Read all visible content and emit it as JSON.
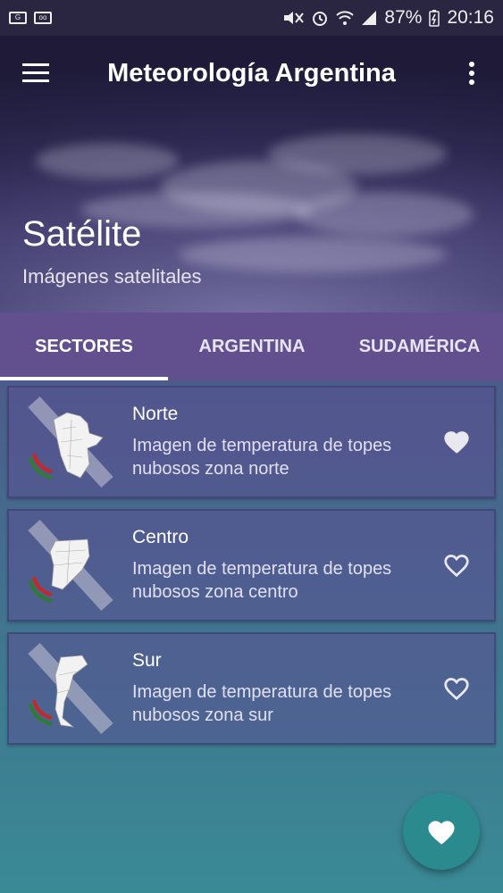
{
  "status_bar": {
    "battery": "87%",
    "time": "20:16",
    "left_icons": [
      "gallery-icon",
      "voicemail-icon"
    ],
    "right_icons": [
      "mute-icon",
      "alarm-icon",
      "wifi-icon",
      "signal-icon",
      "battery-icon"
    ]
  },
  "app_bar": {
    "title": "Meteorología Argentina",
    "menu_icon": "hamburger-menu-icon",
    "more_icon": "more-vert-icon"
  },
  "hero": {
    "title": "Satélite",
    "subtitle": "Imágenes satelitales"
  },
  "tabs": [
    {
      "label": "SECTORES",
      "active": true
    },
    {
      "label": "ARGENTINA",
      "active": false
    },
    {
      "label": "SUDAMÉRICA",
      "active": false
    }
  ],
  "items": [
    {
      "title": "Norte",
      "description": "Imagen de temperatura de topes nubosos zona norte",
      "favorite": true
    },
    {
      "title": "Centro",
      "description": "Imagen de temperatura de topes nubosos zona centro",
      "favorite": false
    },
    {
      "title": "Sur",
      "description": "Imagen de temperatura de topes nubosos zona sur",
      "favorite": false
    }
  ],
  "fab": {
    "icon": "heart-icon"
  },
  "colors": {
    "tab_bar": "#62508e",
    "fab": "#2a8a8e",
    "status_bar": "#2a2540"
  }
}
